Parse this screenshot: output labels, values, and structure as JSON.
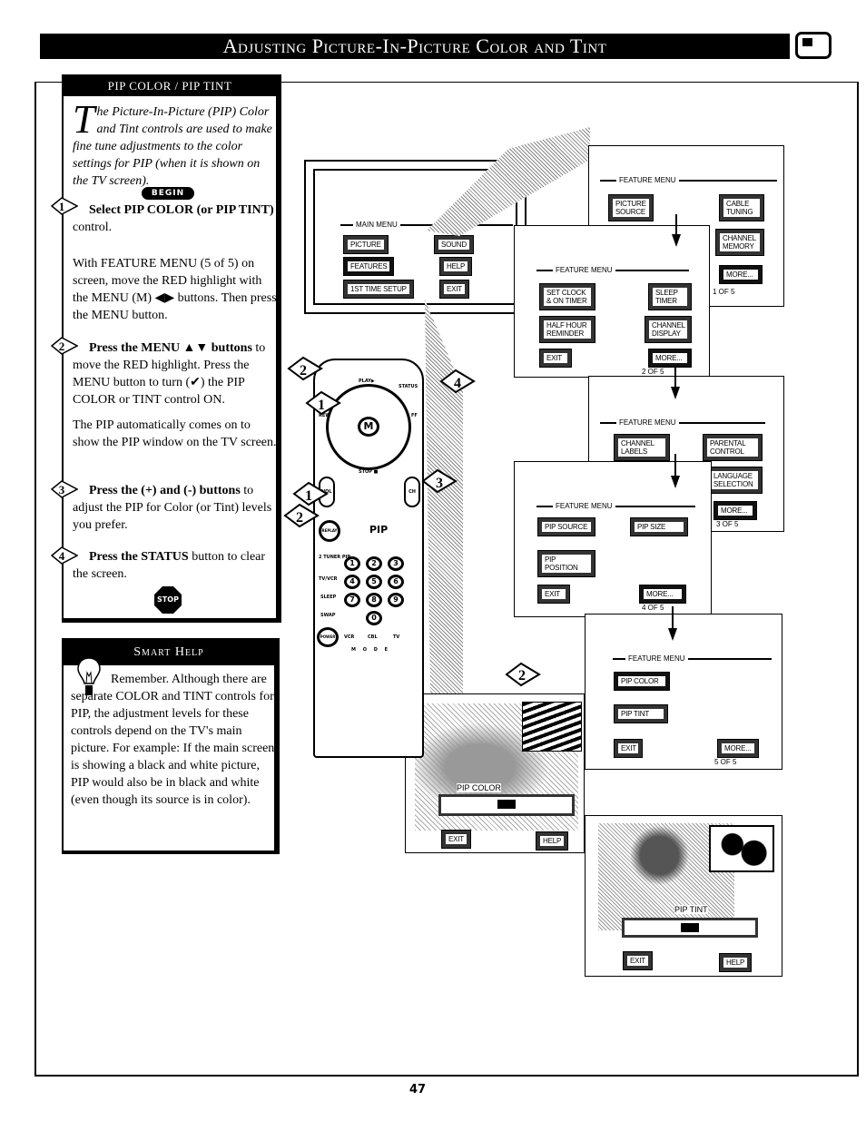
{
  "header": {
    "title": "Adjusting Picture-In-Picture Color and Tint",
    "icon": "tv-screen-icon"
  },
  "instructions": {
    "section_title": "PIP COLOR / PIP TINT",
    "intro_dropcap": "T",
    "intro_text": "he Picture-In-Picture (PIP) Color and Tint controls are used to make fine tune adjustments to the color settings for PIP (when it is shown on the TV screen).",
    "begin_label": "BEGIN",
    "steps": [
      {
        "number": "1",
        "bold": "Select PIP COLOR (or PIP TINT)",
        "text": " control.",
        "detail": "With FEATURE MENU (5 of 5) on screen, move the RED highlight with the MENU (M) ◀▶ buttons. Then press the MENU button."
      },
      {
        "number": "2",
        "bold": "Press the MENU ▲▼  buttons",
        "text": " to move the RED highlight. Press the MENU button to turn (✔) the PIP COLOR or TINT control ON.",
        "detail": "The PIP automatically comes on to show the PIP window on the TV screen."
      },
      {
        "number": "3",
        "bold": "Press the (+) and (-) buttons",
        "text": " to adjust the PIP for Color (or Tint) levels you prefer."
      },
      {
        "number": "4",
        "bold": "Press the STATUS",
        "text": " button to clear the screen."
      }
    ],
    "stop_label": "STOP"
  },
  "smart_help": {
    "title": "Smart Help",
    "text": "Remember. Although there are separate COLOR and TINT controls for PIP, the adjustment levels for these controls depend on the TV's main picture. For example: If the main screen is showing a black and white picture, PIP would also be in black and white (even though its source is in color)."
  },
  "main_menu": {
    "title": "MAIN MENU",
    "buttons": [
      "PICTURE",
      "SOUND",
      "FEATURES",
      "HELP",
      "1ST TIME SETUP",
      "EXIT"
    ],
    "highlighted": "FEATURES"
  },
  "feature_menus": [
    {
      "title": "FEATURE MENU",
      "buttons": [
        "PICTURE SOURCE",
        "CABLE TUNING",
        "CHANNEL MEMORY",
        "MORE..."
      ],
      "page": "1 OF 5",
      "highlighted": "MORE..."
    },
    {
      "title": "FEATURE MENU",
      "buttons": [
        "SET CLOCK & ON TIMER",
        "SLEEP TIMER",
        "HALF HOUR REMINDER",
        "CHANNEL DISPLAY",
        "EXIT",
        "MORE..."
      ],
      "page": "2 OF 5",
      "highlighted": "MORE..."
    },
    {
      "title": "FEATURE MENU",
      "buttons": [
        "CHANNEL LABELS",
        "PARENTAL CONTROL",
        "LANGUAGE SELECTION",
        "MORE..."
      ],
      "page": "3 OF 5",
      "highlighted": "MORE..."
    },
    {
      "title": "FEATURE MENU",
      "buttons": [
        "PIP SOURCE",
        "PIP SIZE",
        "PIP POSITION",
        "EXIT",
        "MORE..."
      ],
      "page": "4 OF 5",
      "highlighted": "MORE..."
    },
    {
      "title": "FEATURE MENU",
      "buttons": [
        "PIP COLOR",
        "PIP TINT",
        "EXIT",
        "MORE..."
      ],
      "page": "5 OF 5",
      "highlighted": "PIP COLOR"
    }
  ],
  "pip_color_screen": {
    "label": "PIP COLOR",
    "exit": "EXIT",
    "help": "HELP",
    "level": 0.5
  },
  "pip_tint_screen": {
    "label": "PIP TINT",
    "exit": "EXIT",
    "help": "HELP",
    "level": 0.5
  },
  "remote": {
    "labels": {
      "play": "PLAY▶",
      "status": "STATUS",
      "rew": "REW",
      "ff": "FF",
      "stop": "STOP ■",
      "menu": "M",
      "vol": "VOL",
      "ch": "CH",
      "replay": "REPLAY",
      "pip": "PIP",
      "power": "POWER",
      "vcr": "VCR",
      "cbl": "CBL",
      "tv": "TV",
      "mode": "M O D E",
      "tvvcr": "TV/VCR",
      "sleep": "SLEEP",
      "swap": "SWAP",
      "tuner_pip": "2 TUNER PIP"
    },
    "digits": [
      "1",
      "2",
      "3",
      "4",
      "5",
      "6",
      "7",
      "8",
      "9",
      "0"
    ],
    "callouts": [
      "2",
      "1",
      "4",
      "1",
      "3",
      "2"
    ]
  },
  "screen_callout": "2",
  "page_number": "47"
}
